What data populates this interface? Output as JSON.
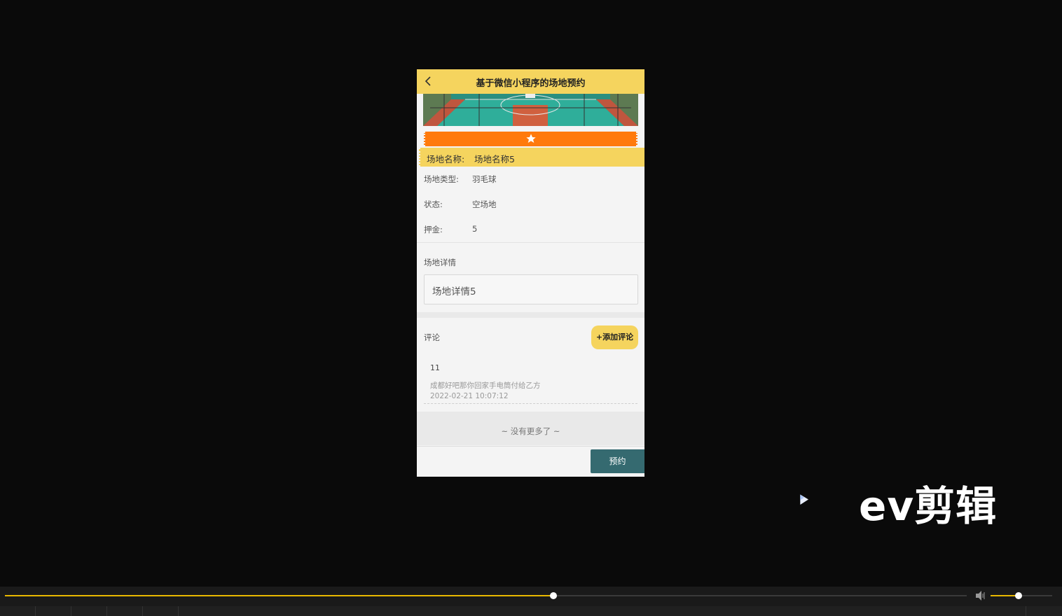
{
  "nav": {
    "title": "基于微信小程序的场地预约"
  },
  "venue": {
    "name_label": "场地名称:",
    "name_value": "场地名称5",
    "type_label": "场地类型:",
    "type_value": "羽毛球",
    "status_label": "状态:",
    "status_value": "空场地",
    "deposit_label": "押金:",
    "deposit_value": "5"
  },
  "detail": {
    "label": "场地详情",
    "content": "场地详情5"
  },
  "comments": {
    "label": "评论",
    "add_button": "+添加评论",
    "items": [
      {
        "user": "11",
        "text": "成都好吧那你回家手电筒付给乙方",
        "time": "2022-02-21 10:07:12"
      }
    ],
    "no_more": "~ 没有更多了 ~"
  },
  "actions": {
    "book_button": "预约"
  },
  "watermark": {
    "text": "ev剪辑"
  },
  "player": {
    "progress": 0.57,
    "volume": 0.45
  },
  "colors": {
    "accent": "#f5d45e",
    "orange": "#ff7a0c",
    "book": "#356a70",
    "progress": "#e8b800"
  }
}
